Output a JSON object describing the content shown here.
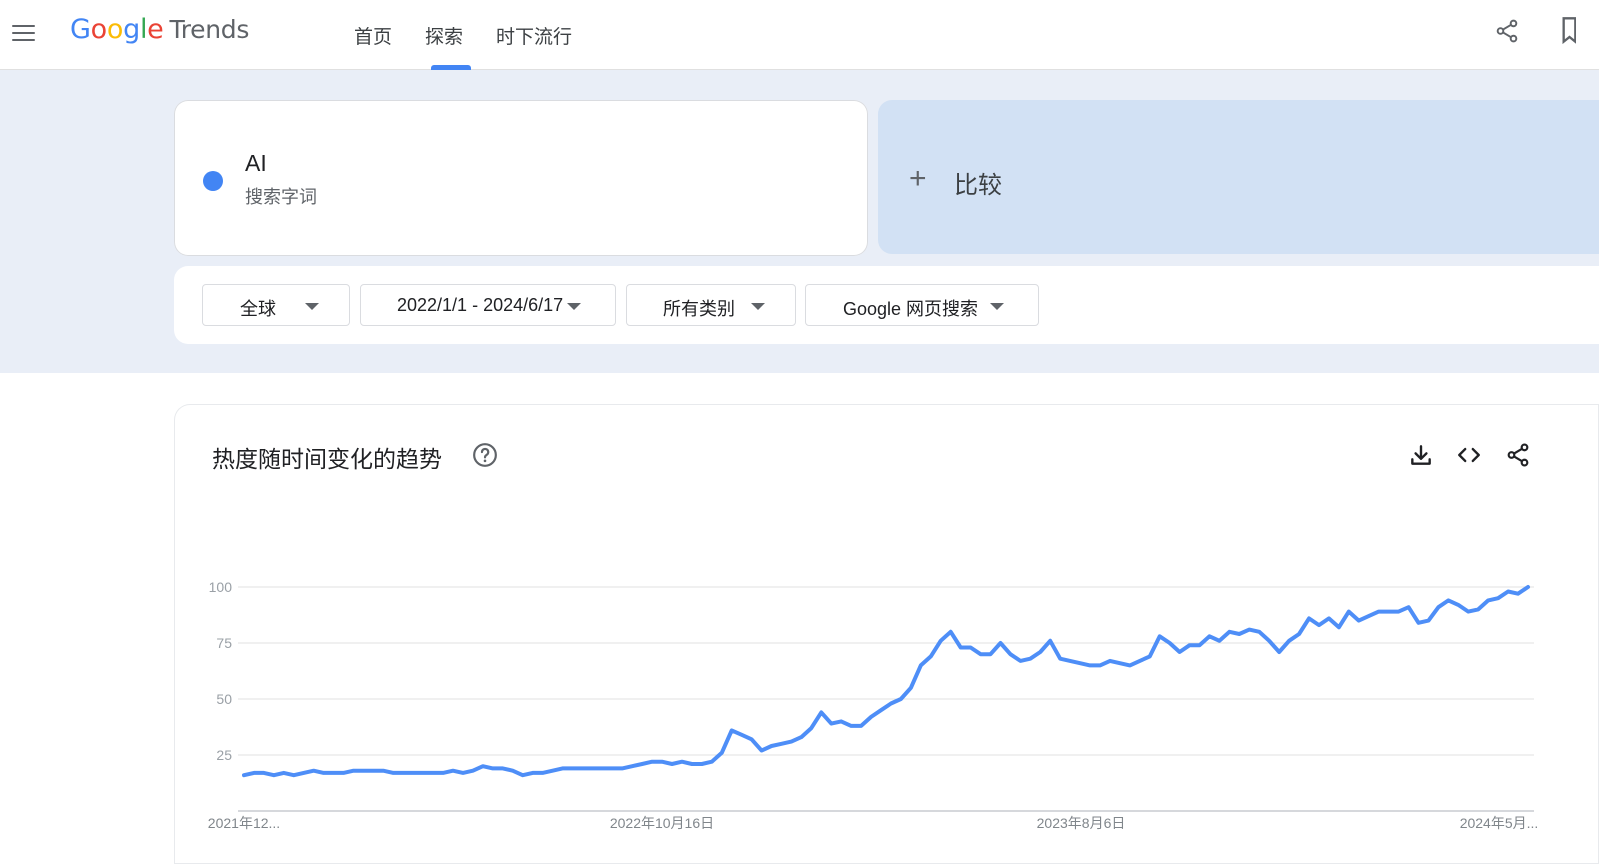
{
  "header": {
    "logo_google": [
      "G",
      "o",
      "o",
      "g",
      "l",
      "e"
    ],
    "logo_colors": [
      "#4285f4",
      "#ea4335",
      "#fbbc05",
      "#4285f4",
      "#34a853",
      "#ea4335"
    ],
    "logo_trends": "Trends",
    "nav": [
      {
        "label": "首页"
      },
      {
        "label": "探索"
      },
      {
        "label": "时下流行"
      }
    ],
    "active_nav": "探索"
  },
  "search_term": {
    "name": "AI",
    "type": "搜索字词",
    "color": "#4285f4"
  },
  "compare": {
    "plus": "+",
    "label": "比较"
  },
  "filters": {
    "region": "全球",
    "date_range": "2022/1/1 - 2024/6/17",
    "category": "所有类别",
    "search_type": "Google 网页搜索"
  },
  "trend_section": {
    "title": "热度随时间变化的趋势",
    "icons": [
      "help-icon",
      "download-icon",
      "embed-icon",
      "share-icon"
    ]
  },
  "chart_data": {
    "type": "line",
    "ylim": [
      0,
      100
    ],
    "yticks": [
      100,
      75,
      50,
      25
    ],
    "grid": true,
    "x_tick_labels": [
      "2021年12...",
      "2022年10月16日",
      "2023年8月6日",
      "2024年5月..."
    ],
    "series": [
      {
        "color": "#4e8ef7",
        "values": [
          16,
          17,
          17,
          16,
          17,
          16,
          17,
          18,
          17,
          17,
          17,
          18,
          18,
          18,
          18,
          17,
          17,
          17,
          17,
          17,
          17,
          18,
          17,
          18,
          20,
          19,
          19,
          18,
          16,
          17,
          17,
          18,
          19,
          19,
          19,
          19,
          19,
          19,
          19,
          20,
          21,
          22,
          22,
          21,
          22,
          21,
          21,
          22,
          26,
          36,
          34,
          32,
          27,
          29,
          30,
          31,
          33,
          37,
          44,
          39,
          40,
          38,
          38,
          42,
          45,
          48,
          50,
          55,
          65,
          69,
          76,
          80,
          73,
          73,
          70,
          70,
          75,
          70,
          67,
          68,
          71,
          76,
          68,
          67,
          66,
          65,
          65,
          67,
          66,
          65,
          67,
          69,
          78,
          75,
          71,
          74,
          74,
          78,
          76,
          80,
          79,
          81,
          80,
          76,
          71,
          76,
          79,
          86,
          83,
          86,
          82,
          89,
          85,
          87,
          89,
          89,
          89,
          91,
          84,
          85,
          91,
          94,
          92,
          89,
          90,
          94,
          95,
          98,
          97,
          100
        ]
      }
    ]
  }
}
